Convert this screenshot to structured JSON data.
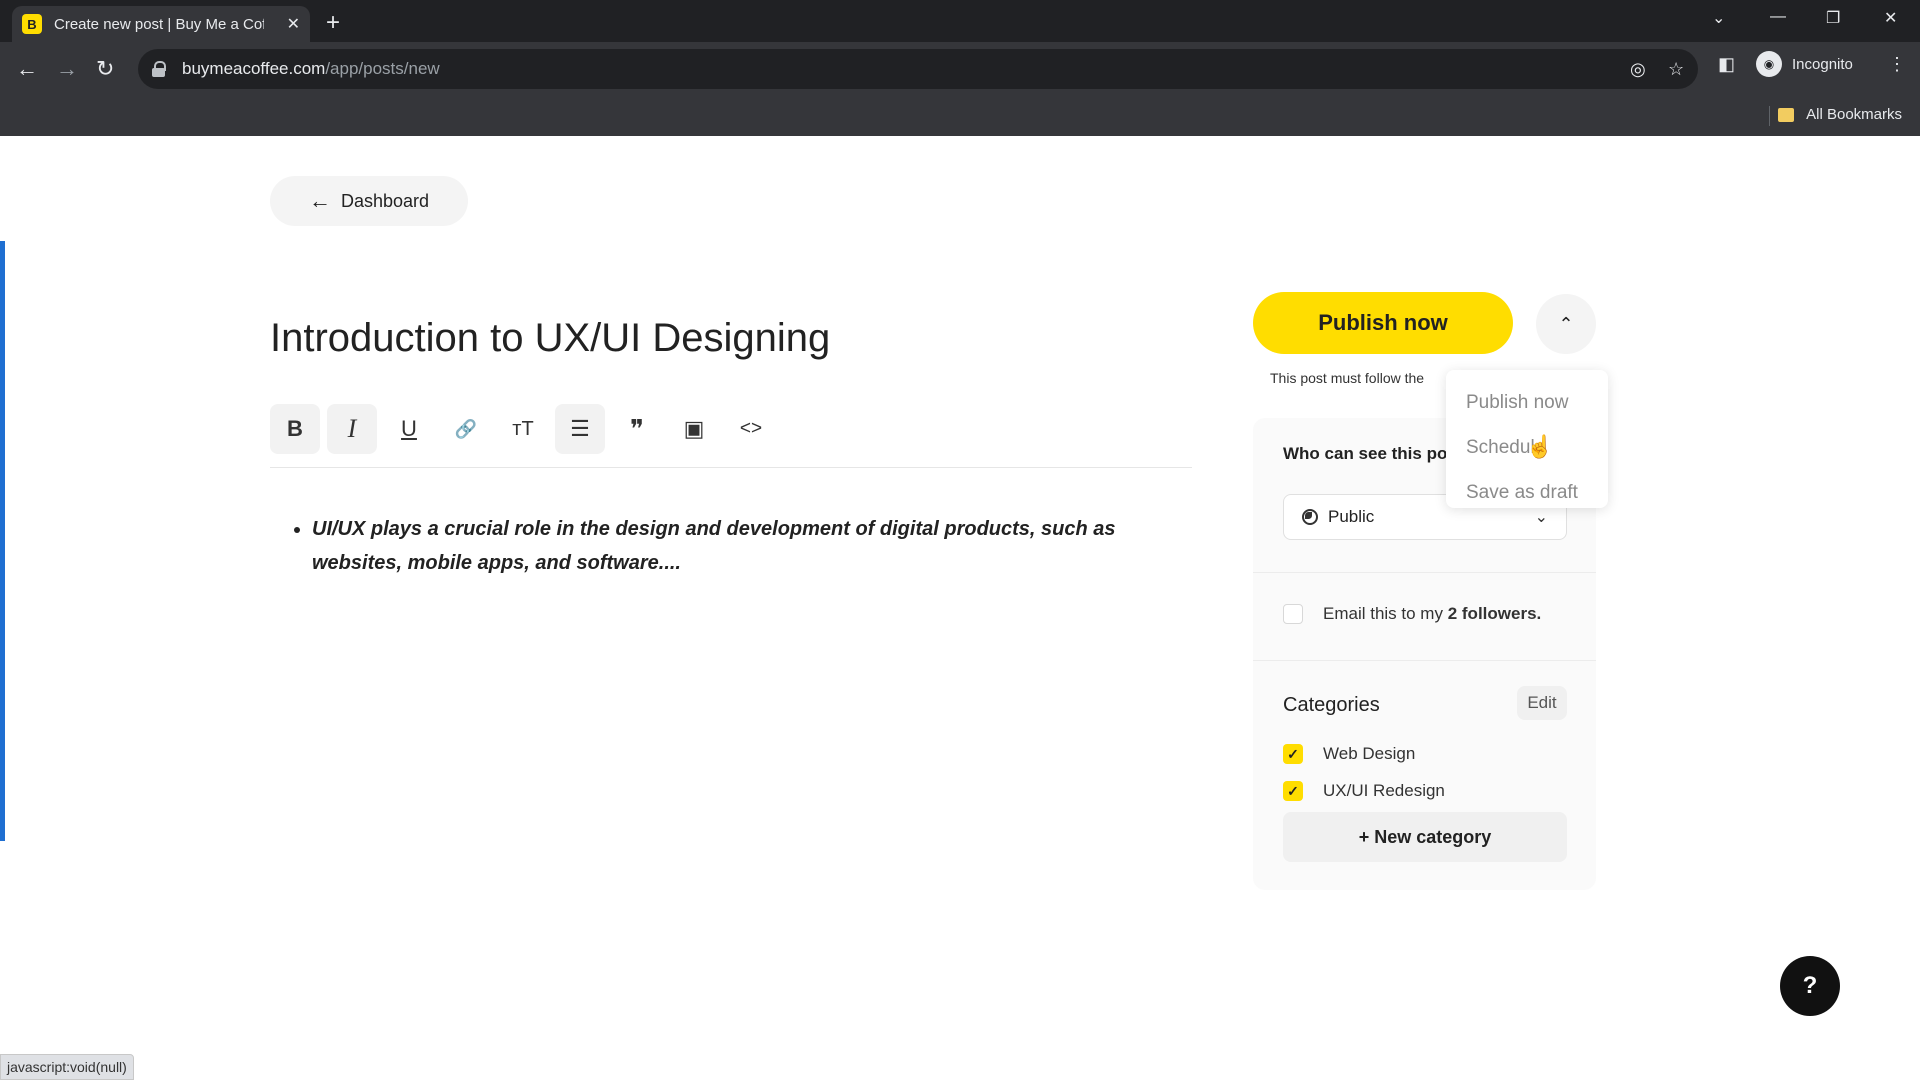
{
  "browser": {
    "tab_title": "Create new post | Buy Me a Coffee",
    "tab_favicon": "B",
    "url_host": "buymeacoffee.com",
    "url_path": "/app/posts/new",
    "profile_label": "Incognito",
    "bookmarks_label": "All Bookmarks"
  },
  "page": {
    "back_label": "Dashboard",
    "post_title": "Introduction to UX/UI Designing",
    "toolbar": {
      "bold": "B",
      "italic": "I",
      "underline": "U",
      "link": "🔗",
      "text_size": "тT",
      "bulleted_list": "☰",
      "quote": "❞",
      "image": "▣",
      "code": "<>"
    },
    "content": [
      "UI/UX plays a crucial role in the design and development of digital products, such as websites, mobile apps, and software...."
    ]
  },
  "publish": {
    "button_label": "Publish now",
    "note": "This post must follow the",
    "menu": [
      "Publish now",
      "Schedule",
      "Save as draft"
    ]
  },
  "sidebar": {
    "who_label": "Who can see this po",
    "visibility": "Public",
    "email_prefix": "Email this to my",
    "email_followers": "2 followers.",
    "categories_title": "Categories",
    "edit_label": "Edit",
    "categories": [
      {
        "label": "Web Design",
        "checked": true
      },
      {
        "label": "UX/UI Redesign",
        "checked": true
      }
    ],
    "new_category_label": "+ New category"
  },
  "help_label": "?",
  "status_text": "javascript:void(null)",
  "colors": {
    "brand_yellow": "#ffdd00",
    "accent_blue": "#1f6fd1"
  }
}
